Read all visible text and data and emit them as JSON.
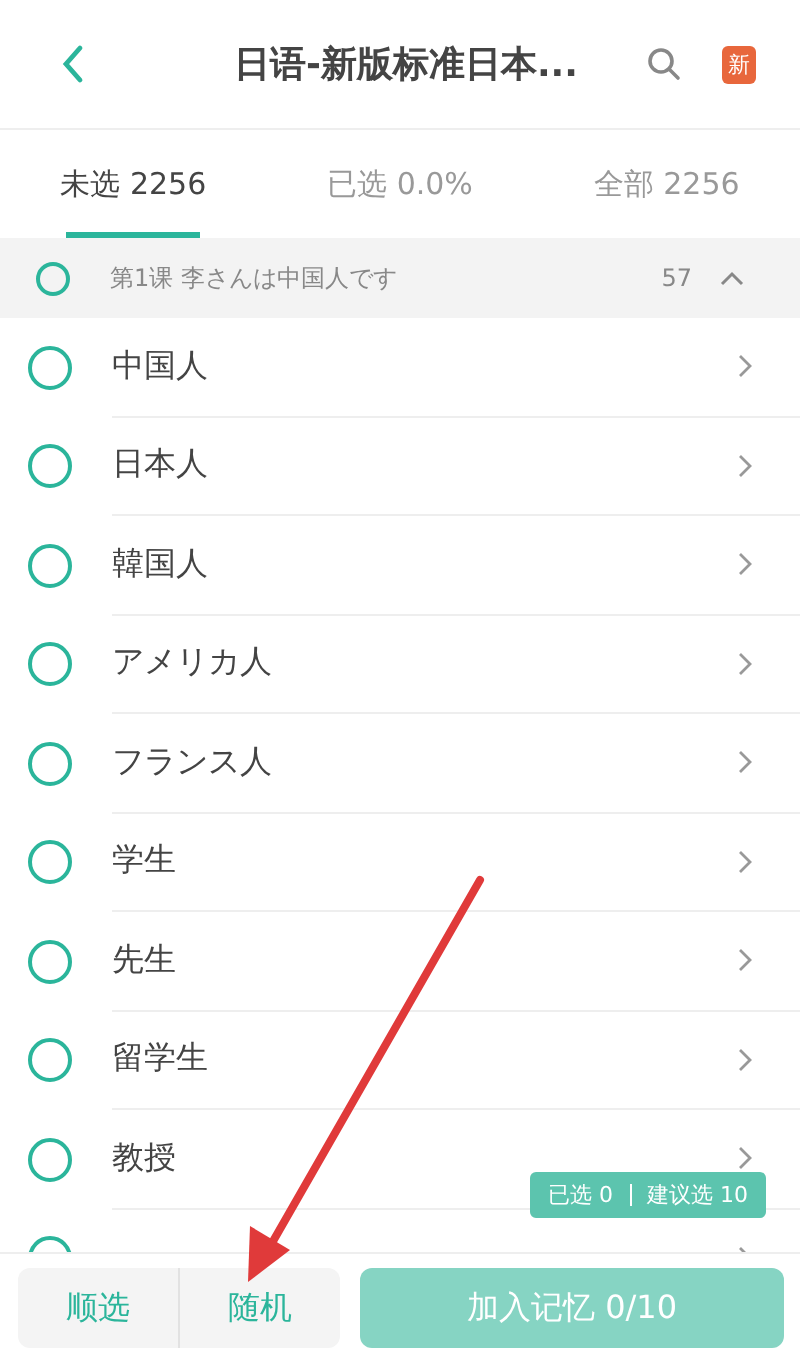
{
  "header": {
    "title": "日语-新版标准日本...",
    "badge": "新"
  },
  "tabs": [
    {
      "label": "未选 2256",
      "selected": true
    },
    {
      "label": "已选 0.0%",
      "selected": false
    },
    {
      "label": "全部 2256",
      "selected": false
    }
  ],
  "group": {
    "title": "第1课 李さんは中国人です",
    "count": "57",
    "checked": false,
    "expanded": true
  },
  "words": [
    {
      "text": "中国人",
      "checked": false
    },
    {
      "text": "日本人",
      "checked": false
    },
    {
      "text": "韓国人",
      "checked": false
    },
    {
      "text": "アメリカ人",
      "checked": false
    },
    {
      "text": "フランス人",
      "checked": false
    },
    {
      "text": "学生",
      "checked": false
    },
    {
      "text": "先生",
      "checked": false
    },
    {
      "text": "留学生",
      "checked": false
    },
    {
      "text": "教授",
      "checked": false
    },
    {
      "checked": false
    }
  ],
  "selection_badge": {
    "selected": "已选 0",
    "suggested": "建议选 10"
  },
  "bottom_bar": {
    "order_button": "顺选",
    "random_button": "随机",
    "add_button": "加入记忆 0/10"
  }
}
